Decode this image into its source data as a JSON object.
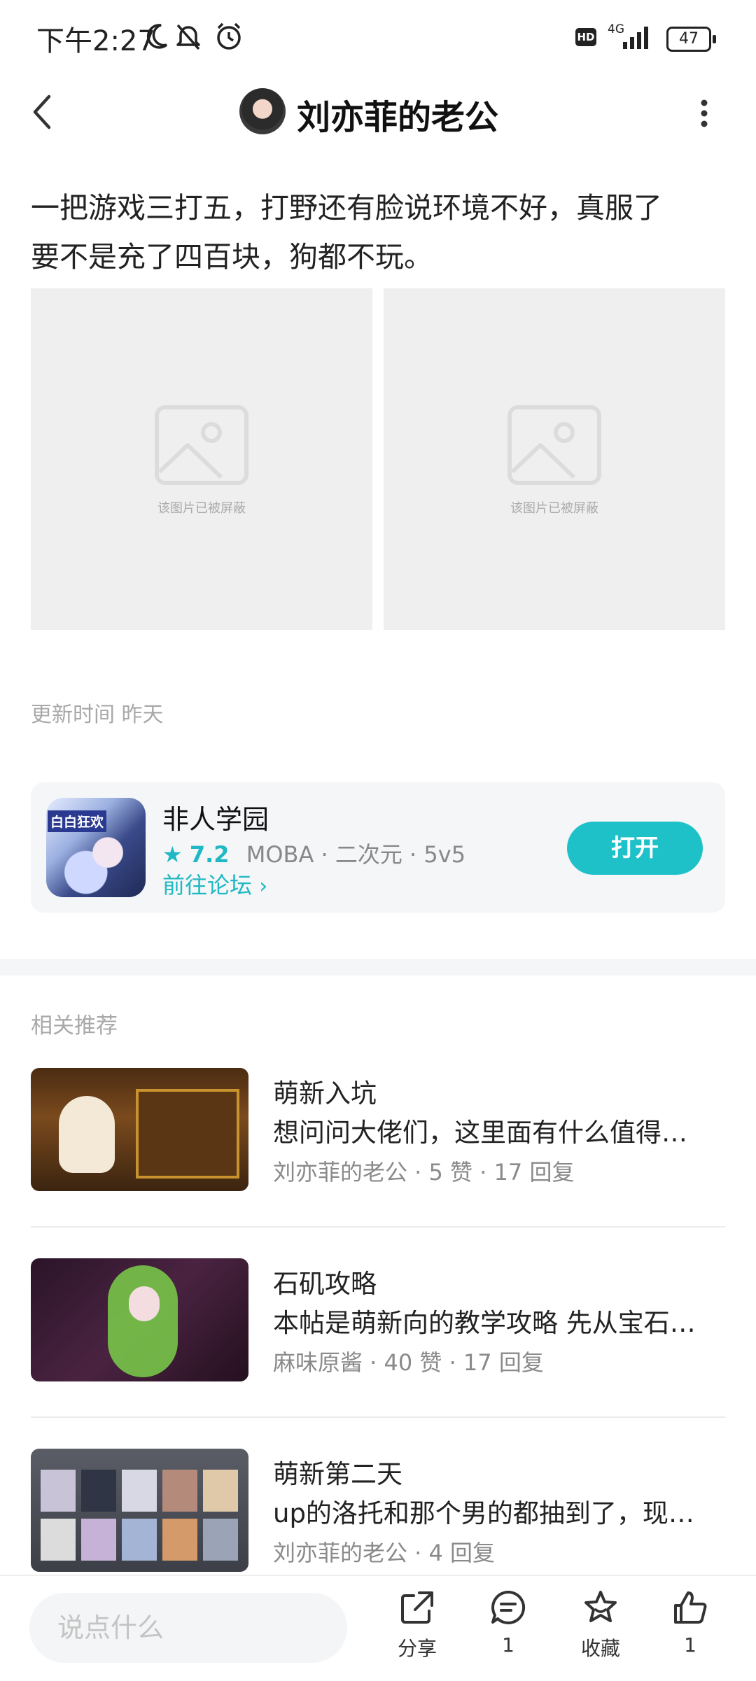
{
  "status_bar": {
    "time": "下午2:27",
    "network": "4G",
    "hd": "HD",
    "battery": "47"
  },
  "header": {
    "title": "刘亦菲的老公"
  },
  "post": {
    "line1": "一把游戏三打五，打野还有脸说环境不好，真服了",
    "line2": "要不是充了四百块，狗都不玩。",
    "images": [
      {
        "caption": "该图片已被屏蔽"
      },
      {
        "caption": "该图片已被屏蔽"
      }
    ],
    "update_time": "更新时间 昨天"
  },
  "game_card": {
    "name": "非人学园",
    "rating": "7.2",
    "tags": "MOBA · 二次元 · 5v5",
    "forum_link": "前往论坛",
    "open_label": "打开",
    "icon_text": "白白狂欢"
  },
  "recommend": {
    "title": "相关推荐",
    "items": [
      {
        "title": "萌新入坑",
        "desc": "想问问大佬们，这里面有什么值得…",
        "meta": "刘亦菲的老公 · 5 赞 · 17 回复"
      },
      {
        "title": "石矶攻略",
        "desc": "本帖是萌新向的教学攻略 先从宝石…",
        "meta": "麻味原酱 · 40 赞 · 17 回复"
      },
      {
        "title": "萌新第二天",
        "desc": "up的洛托和那个男的都抽到了，现…",
        "meta": "刘亦菲的老公 · 4 回复"
      }
    ]
  },
  "bottom_bar": {
    "input_placeholder": "说点什么",
    "share_label": "分享",
    "comment_count": "1",
    "favorite_label": "收藏",
    "like_count": "1"
  },
  "colors": {
    "accent": "#1fc1c9",
    "muted": "#a8a8a8"
  }
}
